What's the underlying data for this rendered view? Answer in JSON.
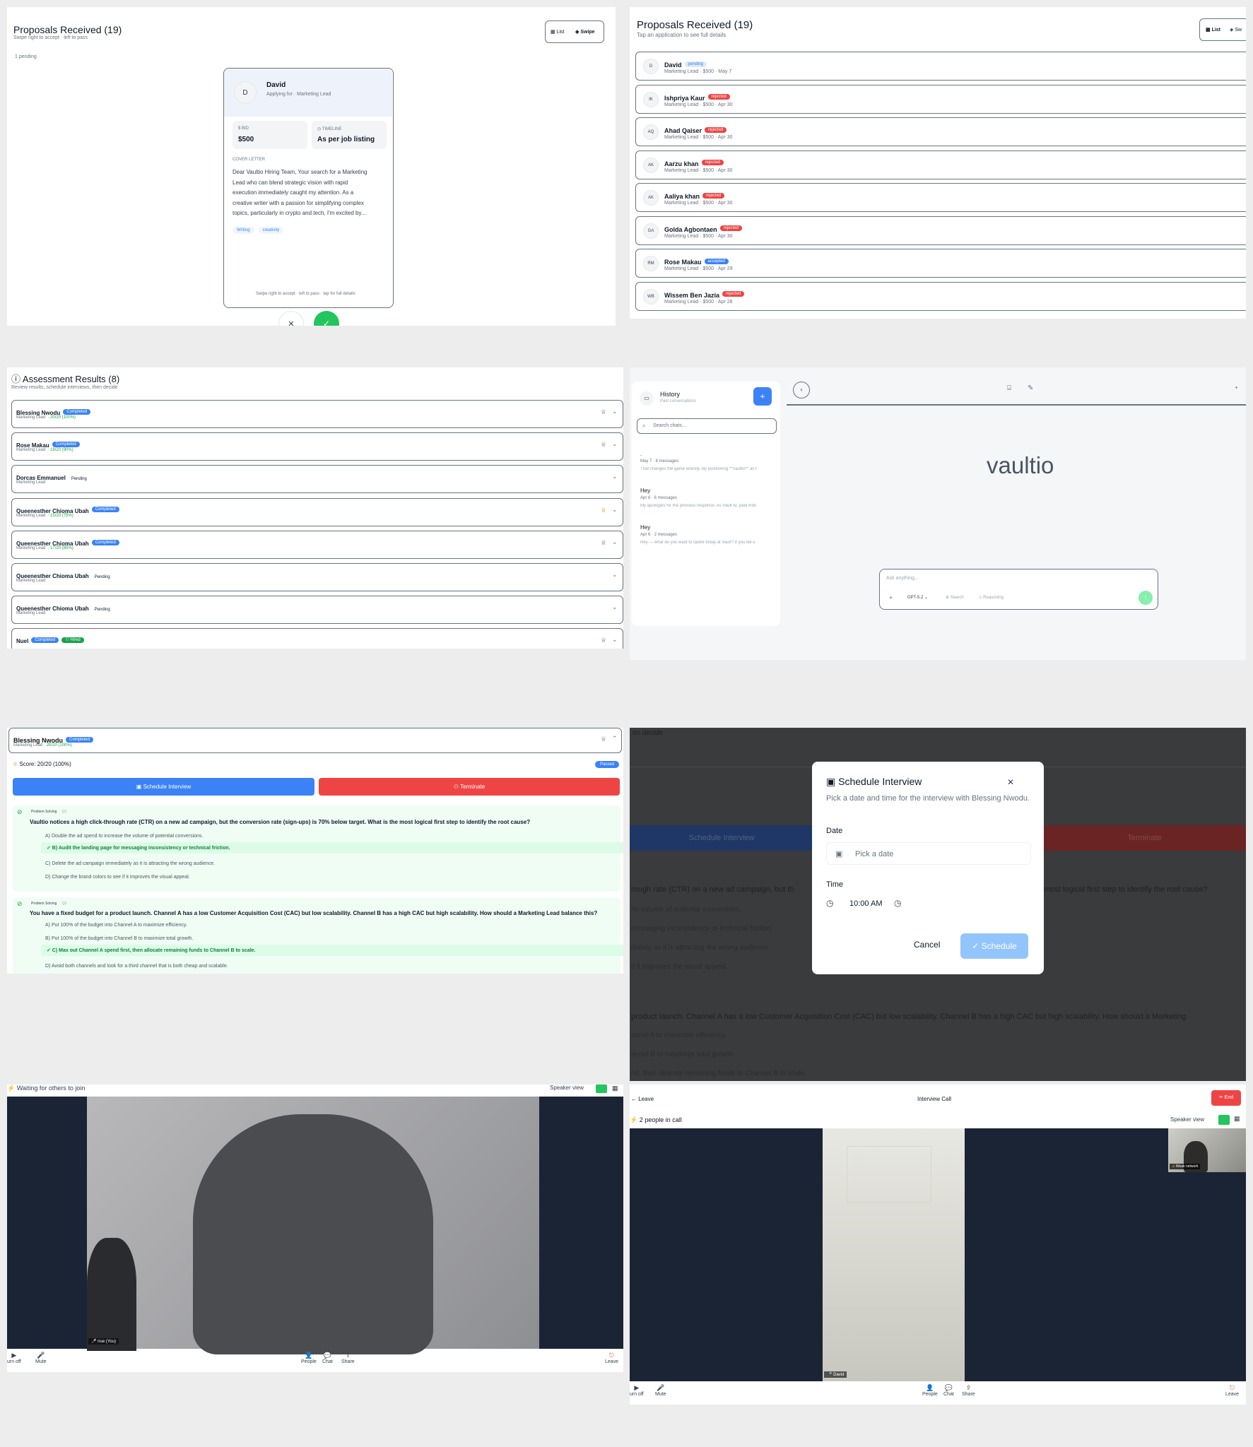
{
  "panel_swipe": {
    "title": "Proposals Received (19)",
    "subtitle": "Swipe right to accept · left to pass",
    "toggle_list": "List",
    "toggle_swipe": "Swipe",
    "pending": "1 pending",
    "card": {
      "avatar": "D",
      "name": "David",
      "applying": "Applying for · Marketing Lead",
      "bid_label": "BID",
      "bid_value": "$500",
      "timeline_label": "TIMELINE",
      "timeline_value": "As per job listing",
      "cover_label": "COVER LETTER",
      "cover_lines": [
        "Dear Vaultio Hiring Team, Your search for a Marketing",
        "Lead who can blend strategic vision with rapid",
        "execution immediately caught my attention. As a",
        "creative writer with a passion for simplifying complex",
        "topics, particularly in crypto and tech, I'm excited by..."
      ],
      "tags": [
        "Writing",
        "creativity"
      ],
      "hint": "Swipe right to accept · left to pass · tap for full details"
    },
    "pass_symbol": "✕",
    "accept_symbol": "✓"
  },
  "panel_list": {
    "title": "Proposals Received (19)",
    "subtitle": "Tap an application to see full details",
    "toggle_list": "List",
    "toggle_swipe": "Sw",
    "rows": [
      {
        "initials": "D",
        "name": "David",
        "status": "pending",
        "meta": "Marketing Lead · $500 · May 7"
      },
      {
        "initials": "IK",
        "name": "Ishpriya Kaur",
        "status": "rejected",
        "meta": "Marketing Lead · $500 · Apr 30"
      },
      {
        "initials": "AQ",
        "name": "Ahad Qaiser",
        "status": "rejected",
        "meta": "Marketing Lead · $500 · Apr 30"
      },
      {
        "initials": "AK",
        "name": "Aarzu khan",
        "status": "rejected",
        "meta": "Marketing Lead · $500 · Apr 30"
      },
      {
        "initials": "AK",
        "name": "Aaliya khan",
        "status": "rejected",
        "meta": "Marketing Lead · $500 · Apr 30"
      },
      {
        "initials": "GA",
        "name": "Golda Agbontaen",
        "status": "rejected",
        "meta": "Marketing Lead · $500 · Apr 30"
      },
      {
        "initials": "RM",
        "name": "Rose Makau",
        "status": "accepted",
        "meta": "Marketing Lead · $500 · Apr 29"
      },
      {
        "initials": "WB",
        "name": "Wissem Ben Jazia",
        "status": "rejected",
        "meta": "Marketing Lead · $500 · Apr 28"
      }
    ]
  },
  "panel_assess": {
    "title": "Assessment Results (8)",
    "subtitle": "Review results, schedule interviews, then decide",
    "rows": [
      {
        "name": "Blessing Nwodu",
        "status": "Completed",
        "role": "Marketing Lead",
        "score": "· 20/20 (100%)",
        "trophy": "gray"
      },
      {
        "name": "Rose Makau",
        "status": "Completed",
        "role": "Marketing Lead",
        "score": "· 18/20 (90%)",
        "trophy": "gray"
      },
      {
        "name": "Dorcas Emmanuel",
        "status": "Pending",
        "role": "Marketing Lead",
        "score": "",
        "trophy": ""
      },
      {
        "name": "Queenesther Chioma Ubah",
        "status": "Completed",
        "role": "Marketing Lead",
        "score": "· 15/20 (75%)",
        "trophy": "gold"
      },
      {
        "name": "Queenesther Chioma Ubah",
        "status": "Completed",
        "role": "Marketing Lead",
        "score": "· 17/20 (85%)",
        "trophy": "gray"
      },
      {
        "name": "Queenesther Chioma Ubah",
        "status": "Pending",
        "role": "Marketing Lead",
        "score": "",
        "trophy": ""
      },
      {
        "name": "Queenesther Chioma Ubah",
        "status": "Pending",
        "role": "Marketing Lead",
        "score": "",
        "trophy": ""
      },
      {
        "name": "Nuel",
        "status": "Completed",
        "extra": "Hired",
        "role": "",
        "score": "",
        "trophy": "gray"
      }
    ]
  },
  "panel_chat": {
    "history_title": "History",
    "history_sub": "Past conversations",
    "search_placeholder": "Search chats...",
    "items": [
      {
        "title": ".",
        "meta": "May 7 · 8 messages",
        "preview": "That changes the game entirely. By positioning **Vaultio** as t"
      },
      {
        "title": "Hey",
        "meta": "Apr 6 · 6 messages",
        "preview": "My apologies for the previous response. As Vault AI, paid indu"
      },
      {
        "title": "Hey",
        "meta": "Apr 6 · 2 messages",
        "preview": "Hey — what do you want to tackle today at Vault? If you tell u"
      }
    ],
    "brand": "vaultio",
    "input_placeholder": "Ask anything...",
    "model": "GPT-5.2",
    "search_chip": "Search",
    "reasoning_chip": "Reasoning"
  },
  "panel_detail": {
    "name": "Blessing Nwodu",
    "status": "Completed",
    "role_score": "Marketing Lead · 20/20 (100%)",
    "score": "Score: 20/20 (100%)",
    "passed": "Passed",
    "schedule_btn": "Schedule Interview",
    "terminate_btn": "Terminate",
    "q1": {
      "tag": "Problem Solving",
      "num": "Q1",
      "text": "Vaultio notices a high click-through rate (CTR) on a new ad campaign, but the conversion rate (sign-ups) is 70% below target. What is the most logical first step to identify the root cause?",
      "options": [
        "A) Double the ad spend to increase the volume of potential conversions.",
        "✓ B) Audit the landing page for messaging inconsistency or technical friction.",
        "C) Delete the ad campaign immediately as it is attracting the wrong audience.",
        "D) Change the brand colors to see if it improves the visual appeal."
      ]
    },
    "q2": {
      "tag": "Problem Solving",
      "num": "Q2",
      "text": "You have a fixed budget for a product launch. Channel A has a low Customer Acquisition Cost (CAC) but low scalability. Channel B has a high CAC but high scalability. How should a Marketing Lead balance this?",
      "options": [
        "A) Put 100% of the budget into Channel A to maximize efficiency.",
        "B) Put 100% of the budget into Channel B to maximize total growth.",
        "✓ C) Max out Channel A spend first, then allocate remaining funds to Channel B to scale.",
        "D) Avoid both channels and look for a third channel that is both cheap and scalable."
      ]
    }
  },
  "panel_modal": {
    "bg_top": "en decide",
    "bg_schedule": "Schedule Interview",
    "bg_terminate": "Terminate",
    "bg_lines": [
      "rough rate (CTR) on a new ad campaign, but th",
      "he volume of potential conversions.",
      "messaging inconsistency or technical friction.",
      "diately as it is attracting the wrong audience.",
      "if it improves the visual appeal.",
      "product launch. Channel A has a low Customer Acquisition Cost (CAC) but low scalability. Channel B has a high CAC but high scalability. How should a Marketing",
      "annel A to maximize efficiency.",
      "annel B to maximize total growth.",
      "rst, then allocate remaining funds to Channel B to scale."
    ],
    "bg_right": "most logical first step to identify the root cause?",
    "title": "Schedule Interview",
    "desc": "Pick a date and time for the interview with Blessing Nwodu.",
    "date_label": "Date",
    "date_placeholder": "Pick a date",
    "time_label": "Time",
    "time_value": "10:00 AM",
    "cancel": "Cancel",
    "schedule": "Schedule"
  },
  "panel_call1": {
    "top": "Waiting for others to join",
    "view": "Speaker view",
    "self_label": "nue (You)",
    "controls": [
      "urn off",
      "Mute",
      "People",
      "Chat",
      "Share",
      "Leave"
    ]
  },
  "panel_call2": {
    "leave": "Leave",
    "title": "Interview Call",
    "end": "End",
    "people": "2 people in call",
    "view": "Speaker view",
    "warn": "Weak network",
    "remote_label": "David",
    "controls": [
      "urn off",
      "Mute",
      "People",
      "Chat",
      "Share",
      "Leave"
    ]
  },
  "colors": {
    "blue": "#3b82f6",
    "red": "#ef4444",
    "green": "#22c55e",
    "dark_video": "#1a2434"
  }
}
